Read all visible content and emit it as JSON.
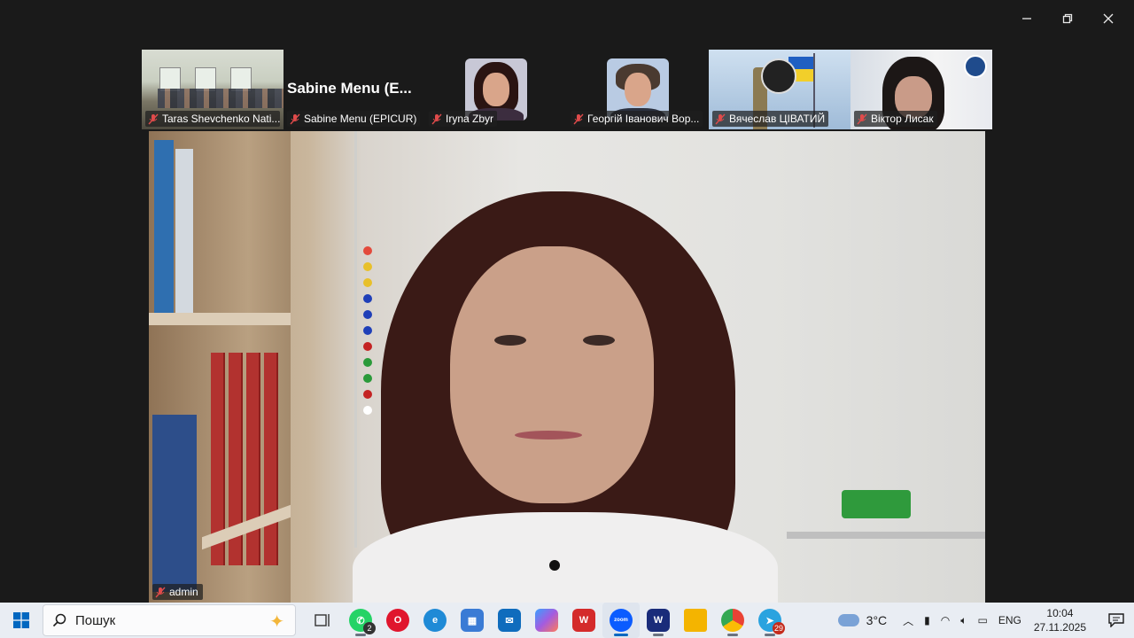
{
  "window_controls": {
    "minimize": "–",
    "restore": "❐",
    "close": "✕"
  },
  "participants": [
    {
      "name": "Taras Shevchenko Nati...",
      "type": "room"
    },
    {
      "name": "Sabine Menu (EPICUR)",
      "display_name": "Sabine  Menu  (E...",
      "type": "text"
    },
    {
      "name": "Iryna Zbyr",
      "type": "portrait"
    },
    {
      "name": "Георгій Іванович Вор...",
      "type": "portrait"
    },
    {
      "name": "Вячеслав ЦІВАТИЙ",
      "type": "flag"
    },
    {
      "name": "Віктор Лисак",
      "type": "office"
    }
  ],
  "main_video": {
    "name": "admin"
  },
  "taskbar": {
    "search_placeholder": "Пошук",
    "apps": [
      {
        "icon": "task-view-icon",
        "label": ""
      },
      {
        "icon": "whatsapp-icon",
        "label": "",
        "badge": "2",
        "color": "#25d366"
      },
      {
        "icon": "opera-icon",
        "label": "",
        "color": "#e0152d"
      },
      {
        "icon": "edge-icon",
        "label": "",
        "color": "#1f8ad6"
      },
      {
        "icon": "store-icon",
        "label": "",
        "color": "#3a7bd5"
      },
      {
        "icon": "outlook-icon",
        "label": "",
        "color": "#0f6cbd"
      },
      {
        "icon": "copilot-icon",
        "label": "",
        "color": "#a35ce0"
      },
      {
        "icon": "wps-icon",
        "label": "W",
        "color": "#d42b2b"
      },
      {
        "icon": "zoom-icon",
        "label": "zoom",
        "color": "#0b5cff",
        "active": true
      },
      {
        "icon": "webex-icon",
        "label": "W",
        "color": "#1a2c7a"
      },
      {
        "icon": "file-explorer-icon",
        "label": "",
        "color": "#f4b400"
      },
      {
        "icon": "chrome-icon",
        "label": "",
        "color": "#34a853"
      },
      {
        "icon": "telegram-icon",
        "label": "",
        "badge": "29",
        "color": "#2aa3df"
      }
    ],
    "weather": "3°C",
    "language": "ENG",
    "time": "10:04",
    "date": "27.11.2025"
  }
}
